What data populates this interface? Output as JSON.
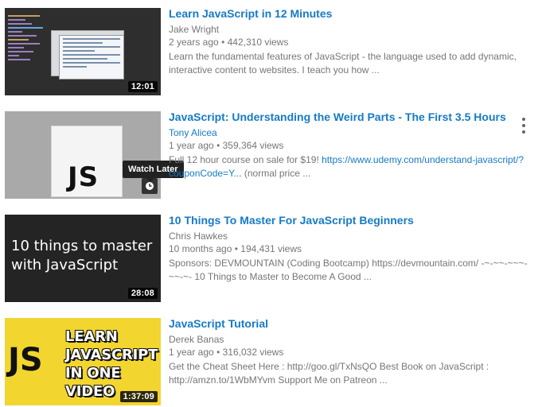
{
  "videos": [
    {
      "title": "Learn JavaScript in 12 Minutes",
      "channel": "Jake Wright",
      "age": "2 years ago",
      "views": "442,310 views",
      "desc_line1": "Learn the fundamental features of JavaScript - the language used to add dynamic,",
      "desc_line2": "interactive content to websites. I teach you how ...",
      "duration": "12:01"
    },
    {
      "title": "JavaScript: Understanding the Weird Parts - The First 3.5 Hours",
      "channel": "Tony Alicea",
      "age": "1 year ago",
      "views": "359,364 views",
      "desc_line1_pre": "Full 12 hour course on sale for $19!",
      "desc_link1": "https://www.udemy.com/understand-javascript/?",
      "desc_link2": "couponCode=Y...",
      "desc_line2_post": "(normal price ...",
      "thumb_text": "JS",
      "tooltip": "Watch Later"
    },
    {
      "title": "10 Things To Master For JavaScript Beginners",
      "channel": "Chris Hawkes",
      "age": "10 months ago",
      "views": "194,431 views",
      "desc_line1": "Sponsors: DEVMOUNTAIN (Coding Bootcamp) https://devmountain.com/ -~-~~-~~~-",
      "desc_line2": "~~-~- 10 Things to Master to Become A Good ...",
      "thumb_line1": "10 things to master",
      "thumb_line2": "with JavaScript",
      "duration": "28:08"
    },
    {
      "title": "JavaScript Tutorial",
      "channel": "Derek Banas",
      "age": "1 year ago",
      "views": "316,032 views",
      "desc_line1": "Get the Cheat Sheet Here : http://goo.gl/TxNsQO Best Book on JavaScript :",
      "desc_line2": "http://amzn.to/1WbMYvm Support Me on Patreon ...",
      "thumb_js": "JS",
      "thumb_l1": "LEARN",
      "thumb_l2": "JAVASCRIPT",
      "thumb_l3": "IN ONE",
      "thumb_l4": "VIDEO",
      "duration": "1:37:09"
    }
  ],
  "separator": "•",
  "colors": {
    "title": "#167ac6",
    "meta": "#767676"
  }
}
